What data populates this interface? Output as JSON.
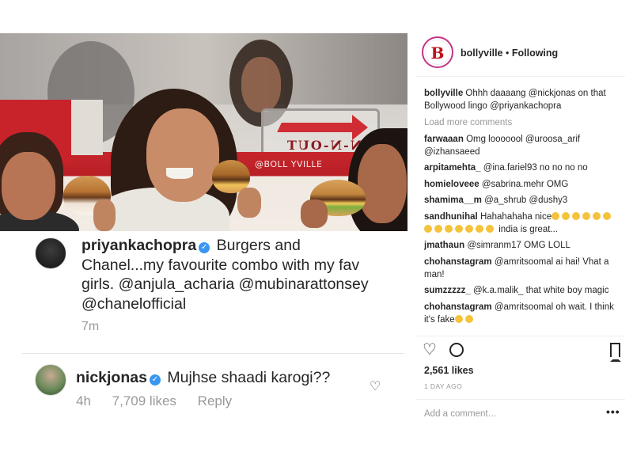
{
  "photo": {
    "watermark": "@BOLL YVILLE",
    "sign_text": "N-N-OUT"
  },
  "caption": {
    "username": "priyankachopra",
    "text": "Burgers and Chanel...my favourite combo with my fav girls. @anjula_acharia @mubinarattonsey @chanelofficial",
    "time": "7m"
  },
  "comment": {
    "username": "nickjonas",
    "text": "Mujhse shaadi karogi??",
    "time": "4h",
    "likes": "7,709 likes",
    "reply": "Reply"
  },
  "post": {
    "account": "bollyville",
    "separator": "•",
    "follow_status": "Following",
    "avatar_letter": "B",
    "load_more": "Load more comments",
    "comments": [
      {
        "user": "bollyville",
        "text": "Ohhh daaaang @nickjonas on that Bollywood lingo @priyankachopra"
      },
      {
        "user": "farwaaan",
        "text": "Omg looooool @uroosa_arif @izhansaeed"
      },
      {
        "user": "arpitamehta_",
        "text": "@ina.fariel93 no no no no"
      },
      {
        "user": "homieloveee",
        "text": "@sabrina.mehr OMG"
      },
      {
        "user": "shamima__m",
        "text": "@a_shrub @dushy3"
      },
      {
        "user": "sandhunihal",
        "text": "Hahahahaha nice",
        "emoji_tail": "india is great..."
      },
      {
        "user": "jmathaun",
        "text": "@simranm17 OMG LOLL"
      },
      {
        "user": "chohanstagram",
        "text": "@amritsoomal ai hai! Vhat a man!"
      },
      {
        "user": "sumzzzzz_",
        "text": "@k.a.malik_ that white boy magic"
      },
      {
        "user": "chohanstagram",
        "text": "@amritsoomal oh wait. I think it's fake"
      }
    ],
    "likes": "2,561 likes",
    "date": "1 DAY AGO",
    "add_comment_placeholder": "Add a comment…",
    "more_label": "•••"
  },
  "colors": {
    "verified": "#3897f0",
    "meta_gray": "#999999",
    "text": "#262626",
    "brand_red": "#c0121b"
  }
}
